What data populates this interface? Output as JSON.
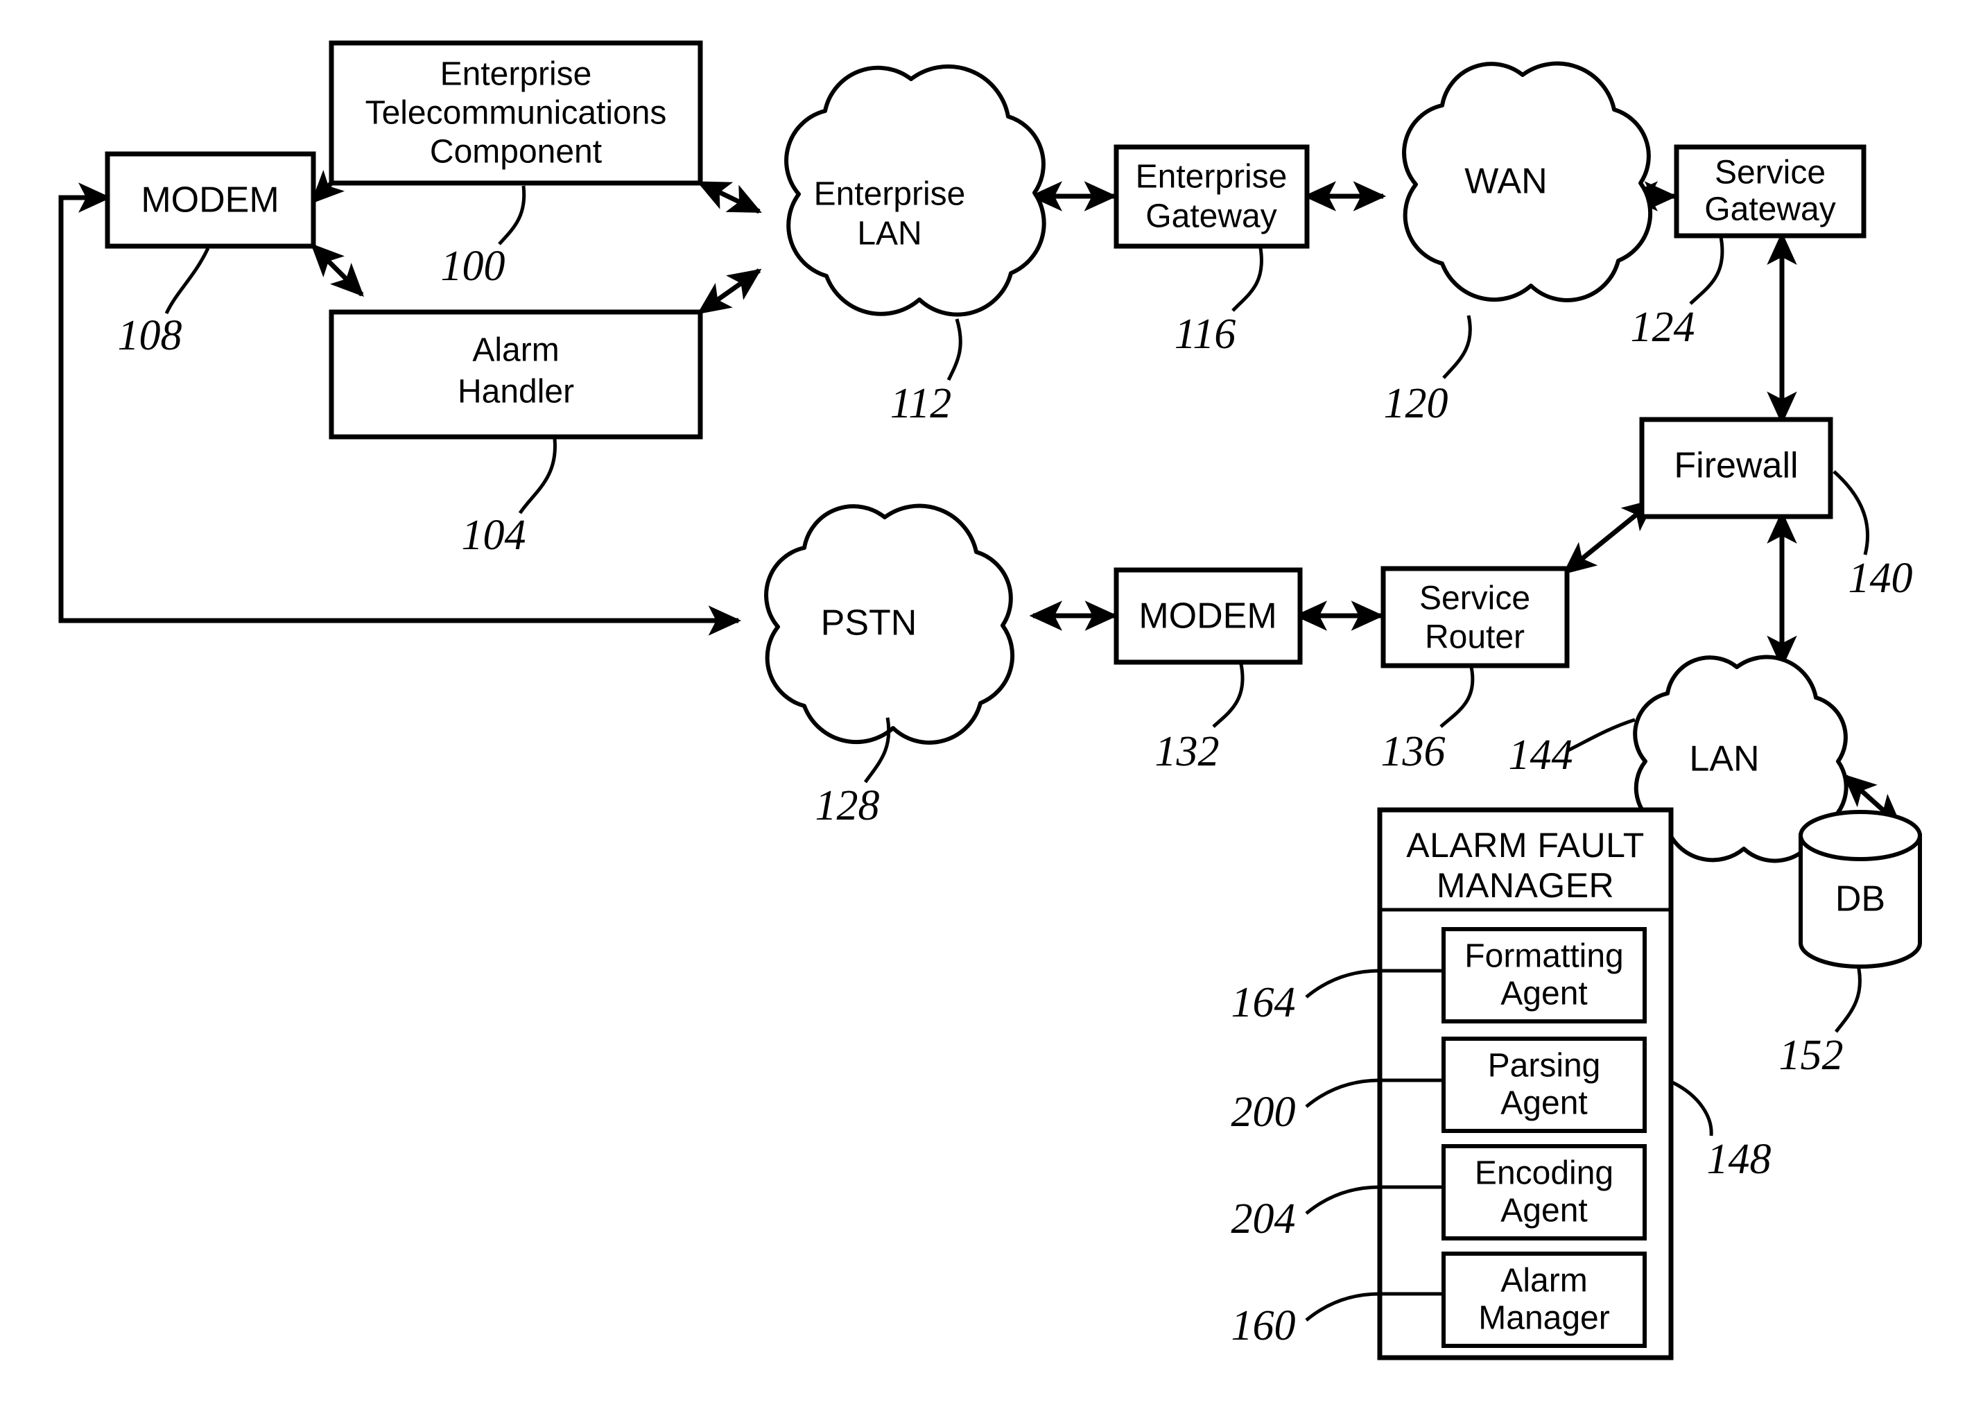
{
  "figure": {
    "type": "patent-network-diagram",
    "background_color": "#ffffff",
    "line_color": "#000000"
  },
  "nodes": {
    "modem_left": {
      "label": "MODEM",
      "ref": "108",
      "shape": "box"
    },
    "enterprise_telecom": {
      "label_line1": "Enterprise",
      "label_line2": "Telecommunications",
      "label_line3": "Component",
      "ref": "100",
      "shape": "box"
    },
    "alarm_handler": {
      "label_line1": "Alarm",
      "label_line2": "Handler",
      "ref": "104",
      "shape": "box"
    },
    "enterprise_lan": {
      "label_line1": "Enterprise",
      "label_line2": "LAN",
      "ref": "112",
      "shape": "cloud"
    },
    "enterprise_gateway": {
      "label_line1": "Enterprise",
      "label_line2": "Gateway",
      "ref": "116",
      "shape": "box"
    },
    "wan": {
      "label": "WAN",
      "ref": "120",
      "shape": "cloud"
    },
    "service_gateway": {
      "label_line1": "Service",
      "label_line2": "Gateway",
      "ref": "124",
      "shape": "box"
    },
    "pstn": {
      "label": "PSTN",
      "ref": "128",
      "shape": "cloud"
    },
    "modem_right": {
      "label": "MODEM",
      "ref": "132",
      "shape": "box"
    },
    "service_router": {
      "label_line1": "Service",
      "label_line2": "Router",
      "ref": "136",
      "shape": "box"
    },
    "firewall": {
      "label": "Firewall",
      "ref": "140",
      "shape": "box"
    },
    "lan": {
      "label": "LAN",
      "ref": "144",
      "shape": "cloud"
    },
    "db": {
      "label": "DB",
      "ref": "152",
      "shape": "cylinder"
    },
    "alarm_fault_manager": {
      "title_line1": "ALARM FAULT",
      "title_line2": "MANAGER",
      "ref": "148",
      "shape": "box",
      "agents": [
        {
          "label_line1": "Formatting",
          "label_line2": "Agent",
          "ref": "164"
        },
        {
          "label_line1": "Parsing",
          "label_line2": "Agent",
          "ref": "200"
        },
        {
          "label_line1": "Encoding",
          "label_line2": "Agent",
          "ref": "204"
        },
        {
          "label_line1": "Alarm",
          "label_line2": "Manager",
          "ref": "160"
        }
      ]
    }
  },
  "reference_numerals": [
    "100",
    "104",
    "108",
    "112",
    "116",
    "120",
    "124",
    "128",
    "132",
    "136",
    "140",
    "144",
    "148",
    "152",
    "160",
    "164",
    "200",
    "204"
  ],
  "connections": [
    {
      "from": "modem_left",
      "to": "enterprise_telecom",
      "arrow": "double"
    },
    {
      "from": "modem_left",
      "to": "alarm_handler",
      "arrow": "double"
    },
    {
      "from": "enterprise_telecom",
      "to": "enterprise_lan",
      "arrow": "double"
    },
    {
      "from": "alarm_handler",
      "to": "enterprise_lan",
      "arrow": "double"
    },
    {
      "from": "enterprise_lan",
      "to": "enterprise_gateway",
      "arrow": "double"
    },
    {
      "from": "enterprise_gateway",
      "to": "wan",
      "arrow": "double"
    },
    {
      "from": "wan",
      "to": "service_gateway",
      "arrow": "double"
    },
    {
      "from": "service_gateway",
      "to": "firewall",
      "arrow": "double"
    },
    {
      "from": "modem_left",
      "to": "pstn",
      "arrow": "single"
    },
    {
      "from": "pstn",
      "to": "modem_right",
      "arrow": "double"
    },
    {
      "from": "modem_right",
      "to": "service_router",
      "arrow": "double"
    },
    {
      "from": "service_router",
      "to": "firewall",
      "arrow": "double"
    },
    {
      "from": "firewall",
      "to": "lan",
      "arrow": "double"
    },
    {
      "from": "lan",
      "to": "alarm_fault_manager",
      "arrow": "double"
    },
    {
      "from": "lan",
      "to": "db",
      "arrow": "double"
    }
  ]
}
